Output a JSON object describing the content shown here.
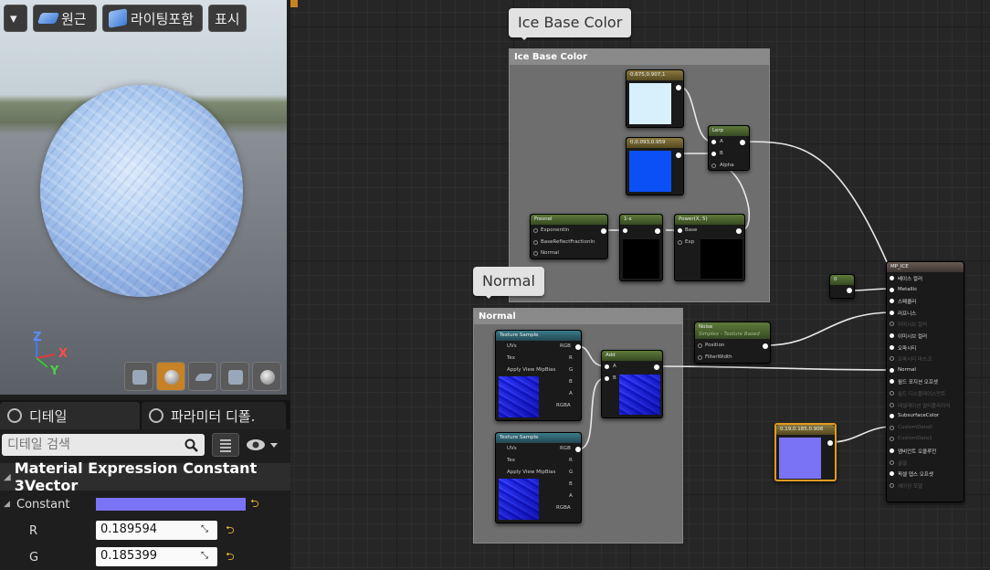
{
  "viewport": {
    "dropdown": "▾",
    "btn_original": "원근",
    "btn_lighting": "라이팅포함",
    "btn_show": "표시",
    "axis_z": "Z",
    "axis_x": "X",
    "axis_y": "Y"
  },
  "tabs": {
    "details": "디테일",
    "params": "파라미터 디폴."
  },
  "search": {
    "placeholder": "디테일 검색"
  },
  "section": {
    "title": "Material Expression Constant 3Vector"
  },
  "props": {
    "constant_label": "Constant",
    "constant_color": "#7b73f5",
    "r_label": "R",
    "r_value": "0.189594",
    "g_label": "G",
    "g_value": "0.185399"
  },
  "graph": {
    "comment1": {
      "bubble": "Ice Base Color",
      "header": "Ice Base Color"
    },
    "comment2": {
      "bubble": "Normal",
      "header": "Normal"
    },
    "const1": {
      "title": "0.675,0.907,1",
      "color": "#d8f0fb"
    },
    "const2": {
      "title": "0,0.093,0.959",
      "color": "#0a50f5"
    },
    "lerp": {
      "title": "Lerp",
      "a": "A",
      "b": "B",
      "alpha": "Alpha"
    },
    "fresnel": {
      "title": "Fresnel",
      "p1": "ExponentIn",
      "p2": "BaseReflectFractionIn",
      "p3": "Normal"
    },
    "oneminus": {
      "title": "1-x"
    },
    "power": {
      "title": "Power(X, 5)",
      "base": "Base",
      "exp": "Exp"
    },
    "const0": {
      "title": "0"
    },
    "noise": {
      "title": "Noise",
      "subtitle": "Simplex - Texture Based",
      "p1": "Position",
      "p2": "FilterWidth"
    },
    "tex1": {
      "title": "Texture Sample",
      "uvs": "UVs",
      "tex": "Tex",
      "mip": "Apply View MipBias",
      "rgb": "RGB",
      "r": "R",
      "g": "G",
      "b": "B",
      "a": "A",
      "rgba": "RGBA"
    },
    "tex2": {
      "title": "Texture Sample",
      "uvs": "UVs",
      "tex": "Tex",
      "mip": "Apply View MipBias",
      "rgb": "RGB",
      "r": "R",
      "g": "G",
      "b": "B",
      "a": "A",
      "rgba": "RGBA"
    },
    "add": {
      "title": "Add",
      "a": "A",
      "b": "B"
    },
    "const3": {
      "title": "0.19,0.185,0.908",
      "color": "#7b73f5"
    },
    "result": {
      "title": "MP_ICE",
      "pins": [
        "베이스 컬러",
        "Metallic",
        "스페큘러",
        "러프니스",
        "이미시브 컬러",
        "이미시브 컬러",
        "오파시티",
        "오파시티 마스크",
        "Normal",
        "월드 포지션 오프셋",
        "월드 디스플레이스먼트",
        "테셀레이션 멀티플라이어",
        "SubsurfaceColor",
        "CustomData0",
        "CustomData1",
        "앰비언트 오클루전",
        "굴절",
        "픽셀 뎁스 오프셋",
        "셰이딩 모델"
      ],
      "active": [
        true,
        true,
        true,
        true,
        false,
        true,
        true,
        false,
        true,
        true,
        false,
        false,
        true,
        false,
        false,
        true,
        false,
        true,
        false
      ]
    }
  }
}
